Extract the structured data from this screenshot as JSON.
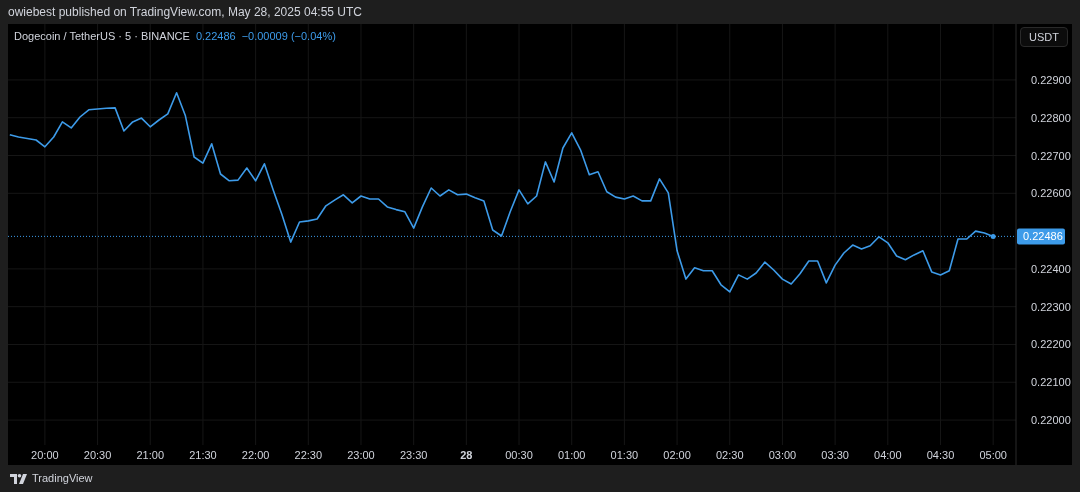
{
  "header": {
    "published": "owiebest published on TradingView.com, May 28, 2025 04:55 UTC"
  },
  "legend": {
    "symbol": "Dogecoin / TetherUS · 5 · BINANCE",
    "price": "0.22486",
    "change": "−0.00009 (−0.04%)"
  },
  "currency_button": "USDT",
  "chart_data": {
    "type": "line",
    "categories": [
      null,
      null,
      null,
      null,
      "20:00",
      null,
      null,
      null,
      null,
      null,
      "20:30",
      null,
      null,
      null,
      null,
      null,
      "21:00",
      null,
      null,
      null,
      null,
      null,
      "21:30",
      null,
      null,
      null,
      null,
      null,
      "22:00",
      null,
      null,
      null,
      null,
      null,
      "22:30",
      null,
      null,
      null,
      null,
      null,
      "23:00",
      null,
      null,
      null,
      null,
      null,
      "23:30",
      null,
      null,
      null,
      null,
      null,
      "28",
      null,
      null,
      null,
      null,
      null,
      "00:30",
      null,
      null,
      null,
      null,
      null,
      "01:00",
      null,
      null,
      null,
      null,
      null,
      "01:30",
      null,
      null,
      null,
      null,
      null,
      "02:00",
      null,
      null,
      null,
      null,
      null,
      "02:30",
      null,
      null,
      null,
      null,
      null,
      "03:00",
      null,
      null,
      null,
      null,
      null,
      "03:30",
      null,
      null,
      null,
      null,
      null,
      "04:00",
      null,
      null,
      null,
      null,
      null,
      "04:30",
      null,
      null,
      null,
      null,
      null,
      "05:00"
    ],
    "series": [
      {
        "color": "#3d9be9",
        "values": [
          0.22755,
          0.22749,
          0.22745,
          0.22741,
          0.22723,
          0.22749,
          0.22789,
          0.22773,
          0.22802,
          0.22821,
          0.22823,
          0.22825,
          0.22826,
          0.22765,
          0.22789,
          0.22799,
          0.22776,
          0.22794,
          0.2281,
          0.22866,
          0.22805,
          0.22696,
          0.2268,
          0.22731,
          0.22651,
          0.22633,
          0.22635,
          0.22667,
          0.22633,
          0.22678,
          0.22609,
          0.22543,
          0.22471,
          0.22524,
          0.22527,
          0.22532,
          0.22567,
          0.22582,
          0.22596,
          0.22575,
          0.22593,
          0.22585,
          0.22585,
          0.22564,
          0.22557,
          0.22551,
          0.22508,
          0.22564,
          0.22614,
          0.22593,
          0.22609,
          0.22596,
          0.22598,
          0.22588,
          0.2258,
          0.22503,
          0.22487,
          0.22551,
          0.22609,
          0.22572,
          0.22593,
          0.22683,
          0.2263,
          0.2272,
          0.2276,
          0.22715,
          0.22649,
          0.22657,
          0.22604,
          0.2259,
          0.22585,
          0.22593,
          0.2258,
          0.2258,
          0.22638,
          0.22601,
          0.22448,
          0.22373,
          0.22403,
          0.22395,
          0.22395,
          0.22358,
          0.22339,
          0.22384,
          0.22373,
          0.22389,
          0.22418,
          0.22397,
          0.22373,
          0.2236,
          0.22387,
          0.22421,
          0.22421,
          0.22363,
          0.2241,
          0.22442,
          0.22463,
          0.22453,
          0.22461,
          0.22485,
          0.22469,
          0.22434,
          0.22424,
          0.22437,
          0.22448,
          0.22392,
          0.22384,
          0.22395,
          0.22479,
          0.22479,
          0.225,
          0.22495,
          0.22486
        ]
      }
    ],
    "ylim": [
      0.21934,
      0.23048
    ],
    "grid": true,
    "ref_lines": [
      {
        "axis": "y",
        "value": 0.22486,
        "label": "0.22486",
        "color": "#3d9be9"
      }
    ],
    "yticks": [
      {
        "value": 0.22,
        "label": "0.22000"
      },
      {
        "value": 0.221,
        "label": "0.22100"
      },
      {
        "value": 0.222,
        "label": "0.22200"
      },
      {
        "value": 0.223,
        "label": "0.22300"
      },
      {
        "value": 0.224,
        "label": "0.22400"
      },
      {
        "value": 0.226,
        "label": "0.22600"
      },
      {
        "value": 0.227,
        "label": "0.22700"
      },
      {
        "value": 0.228,
        "label": "0.22800"
      },
      {
        "value": 0.229,
        "label": "0.22900"
      }
    ]
  },
  "footer": {
    "brand": "TradingView"
  }
}
